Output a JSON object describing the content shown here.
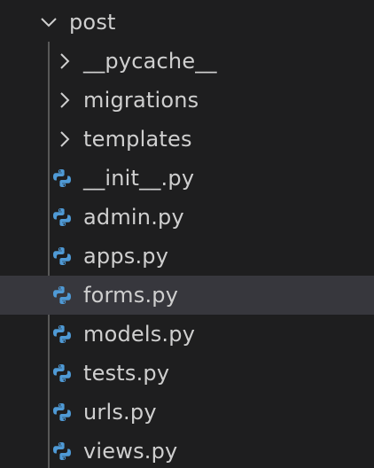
{
  "explorer": {
    "folder": {
      "label": "post",
      "icon": "chevron-down-icon",
      "expanded": true
    },
    "subfolders": [
      {
        "label": "__pycache__",
        "icon": "chevron-right-icon"
      },
      {
        "label": "migrations",
        "icon": "chevron-right-icon"
      },
      {
        "label": "templates",
        "icon": "chevron-right-icon"
      }
    ],
    "files": [
      {
        "label": "__init__.py",
        "icon": "python-file-icon"
      },
      {
        "label": "admin.py",
        "icon": "python-file-icon"
      },
      {
        "label": "apps.py",
        "icon": "python-file-icon"
      },
      {
        "label": "forms.py",
        "icon": "python-file-icon",
        "selected": true
      },
      {
        "label": "models.py",
        "icon": "python-file-icon"
      },
      {
        "label": "tests.py",
        "icon": "python-file-icon"
      },
      {
        "label": "urls.py",
        "icon": "python-file-icon"
      },
      {
        "label": "views.py",
        "icon": "python-file-icon"
      }
    ],
    "colors": {
      "background": "#1e1e1f",
      "selected_row": "#37373d",
      "text": "#cfcfcf",
      "indent_guide": "#585858",
      "python_icon": "#4f9ad6"
    }
  }
}
